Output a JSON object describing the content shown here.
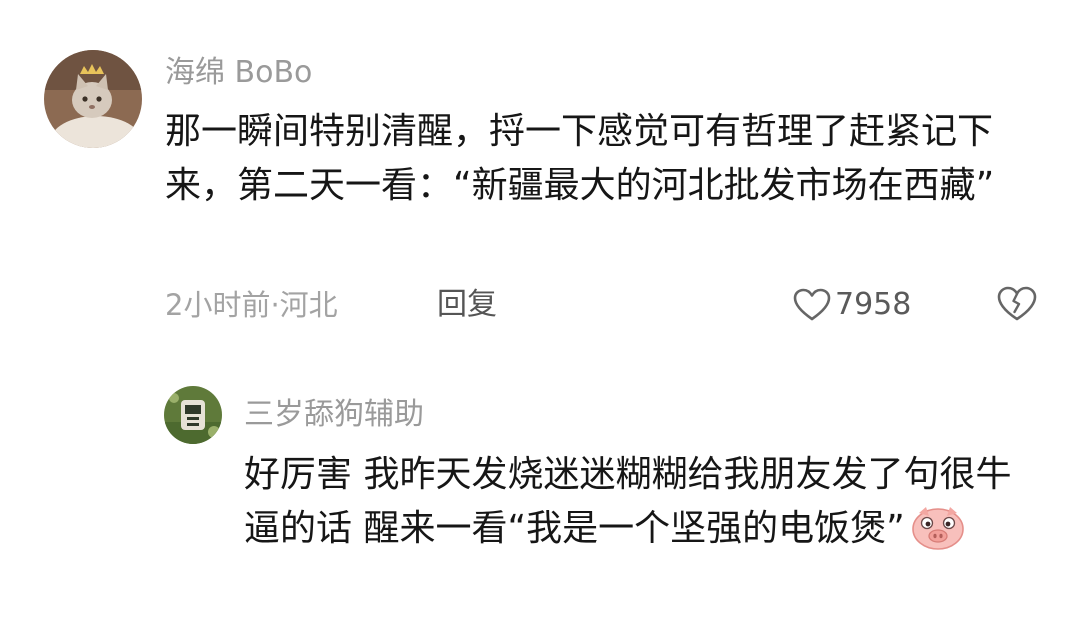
{
  "comment": {
    "username": "海绵 BoBo",
    "text": "那一瞬间特别清醒，捋一下感觉可有哲理了赶紧记下来，第二天一看：“新疆最大的河北批发市场在西藏”",
    "time_location": "2小时前·河北",
    "reply_label": "回复",
    "like_count": "7958",
    "avatar_icon": "cat-avatar-icon",
    "like_icon": "heart-outline-icon",
    "dislike_icon": "broken-heart-icon"
  },
  "reply": {
    "username": "三岁舔狗辅助",
    "text": "好厉害  我昨天发烧迷迷糊糊给我朋友发了句很牛逼的话  醒来一看“我是一个坚强的电饭煲”",
    "avatar_icon": "cartoon-avatar-icon",
    "emoji_icon": "pig-face-emoji"
  },
  "colors": {
    "username": "#9a9a9a",
    "body": "#161616",
    "meta": "#a3a3a3",
    "pig": "#f6b7b3"
  }
}
